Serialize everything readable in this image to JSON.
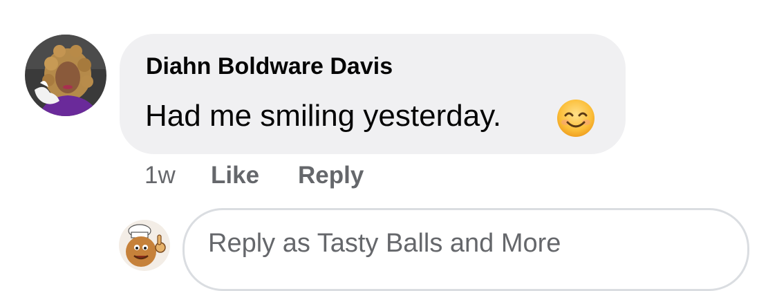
{
  "comment": {
    "author": "Diahn Boldware Davis",
    "text": "Had me smiling yesterday.",
    "emoji": "smiling-face-with-smiling-eyes"
  },
  "actions": {
    "time": "1w",
    "like_label": "Like",
    "reply_label": "Reply"
  },
  "reply_input": {
    "placeholder": "Reply as Tasty Balls and More",
    "value": ""
  },
  "colors": {
    "bubble": "#f0f0f2",
    "meta_text": "#65676b",
    "primary_text": "#050505",
    "input_border": "#dadde1"
  }
}
